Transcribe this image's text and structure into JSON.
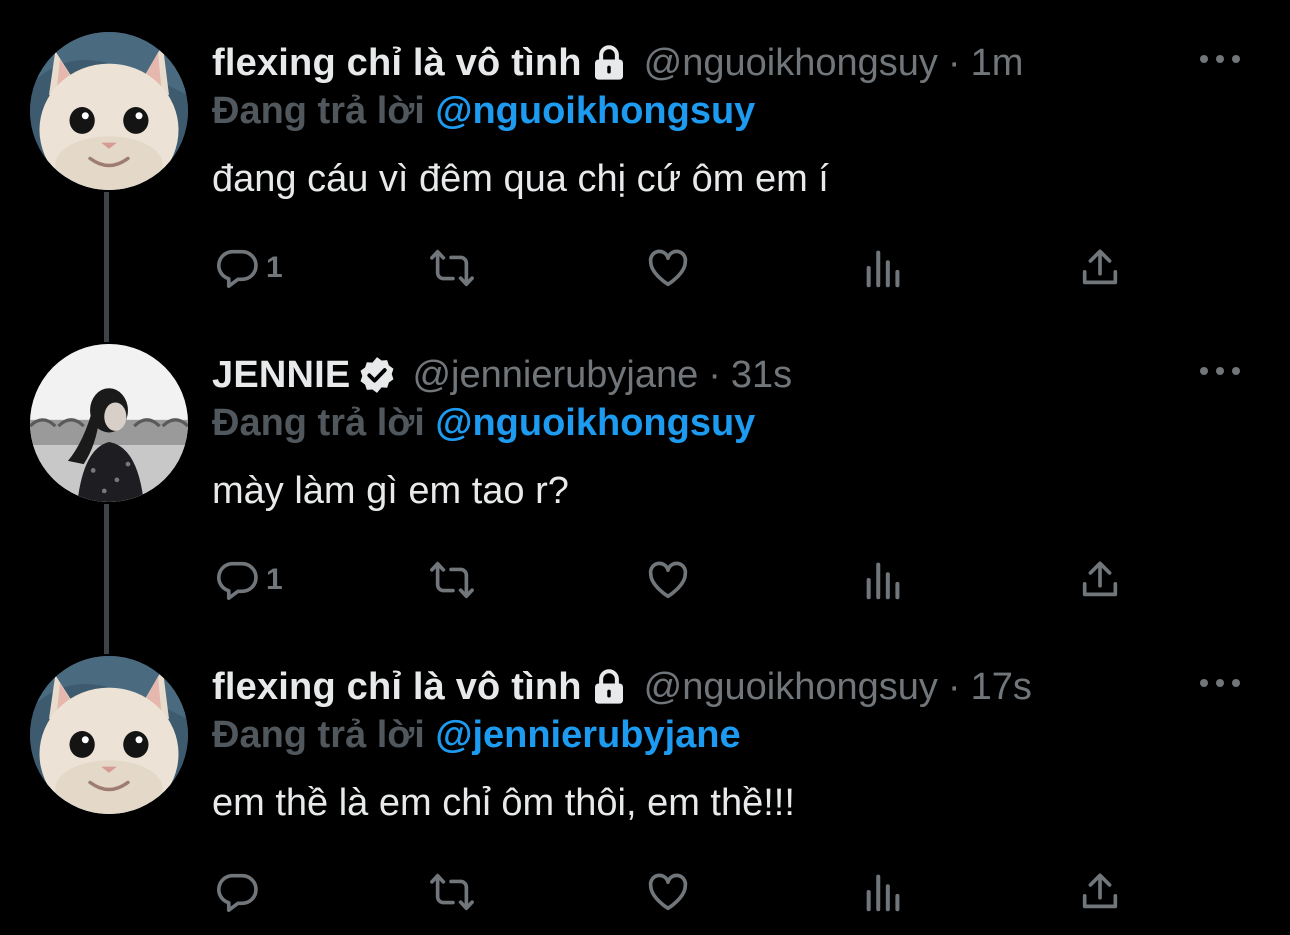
{
  "colors": {
    "accent": "#1d9bf0",
    "muted": "#71767b",
    "background": "#000000",
    "text": "#e7e9ea"
  },
  "tweets": [
    {
      "display_name": "flexing chỉ là vô tình",
      "badge": "lock-icon",
      "handle": "@nguoikhongsuy",
      "separator": "·",
      "time": "1m",
      "replying_prefix": "Đang trả lời",
      "replying_to": "@nguoikhongsuy",
      "text": "đang cáu vì đêm qua chị cứ ôm em í",
      "reply_count": "1",
      "avatar": "cat-avatar"
    },
    {
      "display_name": "JENNIE",
      "badge": "verified-icon",
      "handle": "@jennierubyjane",
      "separator": "·",
      "time": "31s",
      "replying_prefix": "Đang trả lời",
      "replying_to": "@nguoikhongsuy",
      "text": "mày làm gì em tao r?",
      "reply_count": "1",
      "avatar": "photo-avatar"
    },
    {
      "display_name": "flexing chỉ là vô tình",
      "badge": "lock-icon",
      "handle": "@nguoikhongsuy",
      "separator": "·",
      "time": "17s",
      "replying_prefix": "Đang trả lời",
      "replying_to": "@jennierubyjane",
      "text": "em thề là em chỉ ôm thôi, em thề!!!",
      "reply_count": "",
      "avatar": "cat-avatar"
    }
  ]
}
